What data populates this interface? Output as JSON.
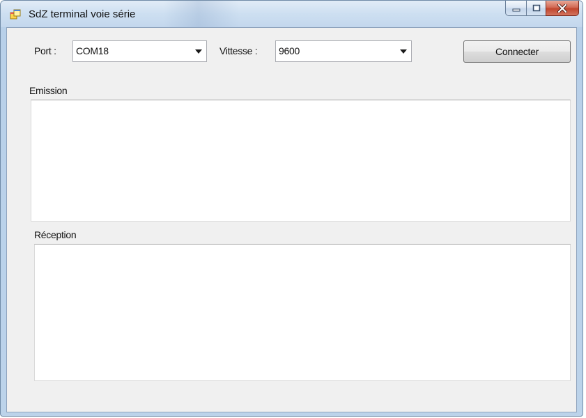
{
  "window": {
    "title": "SdZ terminal voie série",
    "icon": "winforms-app-icon",
    "caption_buttons": [
      "minimize-icon",
      "maximize-icon",
      "close-icon"
    ]
  },
  "toolbar": {
    "port_label": "Port :",
    "port_value": "COM18",
    "speed_label": "Vittesse :",
    "speed_value": "9600",
    "connect_label": "Connecter"
  },
  "emission": {
    "label": "Emission",
    "value": ""
  },
  "reception": {
    "label": "Réception",
    "value": ""
  }
}
